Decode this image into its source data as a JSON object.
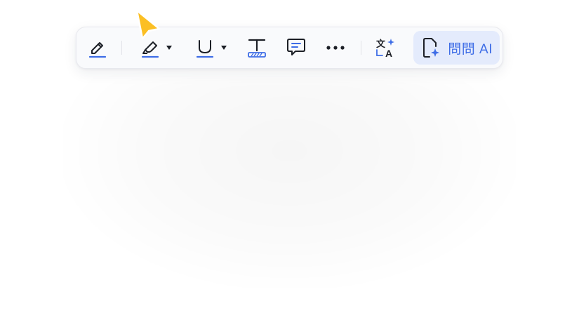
{
  "toolbar": {
    "tools": [
      {
        "name": "pen",
        "icon": "pencil-icon"
      },
      {
        "name": "highlighter",
        "icon": "highlighter-icon",
        "has_dropdown": true
      },
      {
        "name": "underline",
        "icon": "underline-icon",
        "has_dropdown": true
      },
      {
        "name": "text-box",
        "icon": "text-box-icon"
      },
      {
        "name": "comment",
        "icon": "comment-icon"
      },
      {
        "name": "more",
        "icon": "more-icon"
      },
      {
        "name": "translate",
        "icon": "translate-icon"
      }
    ],
    "ai_button": {
      "label": "問問 AI",
      "icon": "ai-document-icon"
    }
  },
  "colors": {
    "accent": "#3e6de6",
    "ai_button_bg": "#e4ebfc",
    "icon_dark": "#1c1f26",
    "cursor": "#fbbf24"
  }
}
